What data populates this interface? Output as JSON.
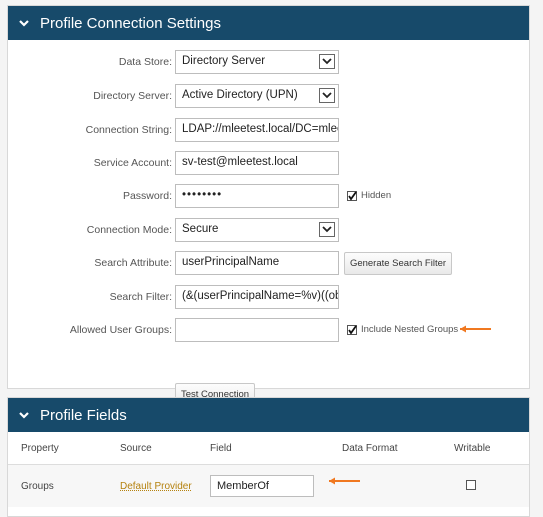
{
  "connection_panel": {
    "title": "Profile Connection Settings",
    "data_store": {
      "label": "Data Store:",
      "value": "Directory Server"
    },
    "directory_server": {
      "label": "Directory Server:",
      "value": "Active Directory (UPN)"
    },
    "connection_string": {
      "label": "Connection String:",
      "value": "LDAP://mleetest.local/DC=mleete"
    },
    "service_account": {
      "label": "Service Account:",
      "value": "sv-test@mleetest.local"
    },
    "password": {
      "label": "Password:",
      "value": "••••••••",
      "hidden_label": "Hidden",
      "hidden_checked": true
    },
    "connection_mode": {
      "label": "Connection Mode:",
      "value": "Secure"
    },
    "search_attribute": {
      "label": "Search Attribute:",
      "value": "userPrincipalName",
      "button": "Generate Search Filter"
    },
    "search_filter": {
      "label": "Search Filter:",
      "value": "(&(userPrincipalName=%v)((obje"
    },
    "allowed_user_groups": {
      "label": "Allowed User Groups:",
      "value": "",
      "nested_label": "Include Nested Groups",
      "nested_checked": true
    },
    "test_button": "Test Connection"
  },
  "fields_panel": {
    "title": "Profile Fields",
    "columns": [
      "Property",
      "Source",
      "Field",
      "Data Format",
      "Writable"
    ],
    "rows": [
      {
        "property": "Groups",
        "source": "Default Provider",
        "field": "MemberOf",
        "data_format": "",
        "writable": false
      }
    ]
  },
  "colors": {
    "header": "#174a6a",
    "annotation_arrow": "#f07820",
    "link": "#b5820f"
  }
}
